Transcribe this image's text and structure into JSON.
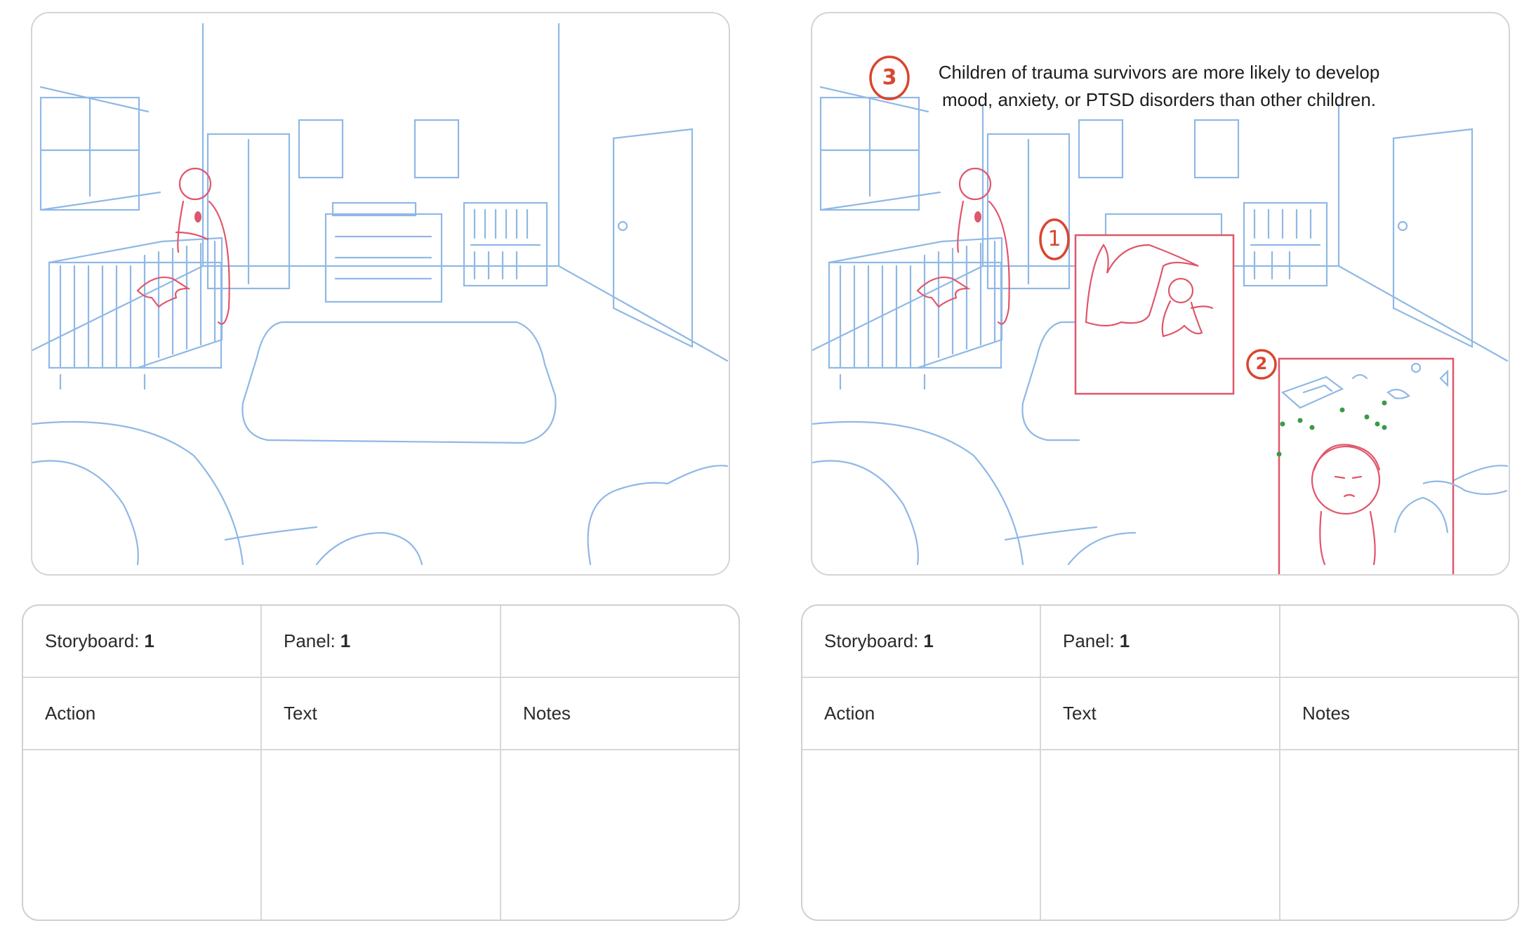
{
  "panels": [
    {
      "id": "left",
      "storyboard_label": "Storyboard:",
      "storyboard_value": "1",
      "panel_label": "Panel:",
      "panel_value": "1",
      "columns": [
        "Action",
        "Text",
        "Notes"
      ]
    },
    {
      "id": "right",
      "storyboard_label": "Storyboard:",
      "storyboard_value": "1",
      "panel_label": "Panel:",
      "panel_value": "1",
      "columns": [
        "Action",
        "Text",
        "Notes"
      ],
      "caption_line1": "Children of trauma survivors are more likely to develop",
      "caption_line2": "mood, anxiety, or PTSD disorders than other children.",
      "callout_numbers": [
        "1",
        "2",
        "3"
      ]
    }
  ],
  "colors": {
    "sketch_blue": "#8fb8e6",
    "sketch_red": "#e0566a",
    "callout_orange": "#d9462f",
    "dots_green": "#3a9a4a",
    "border_gray": "#d4d4d4"
  }
}
